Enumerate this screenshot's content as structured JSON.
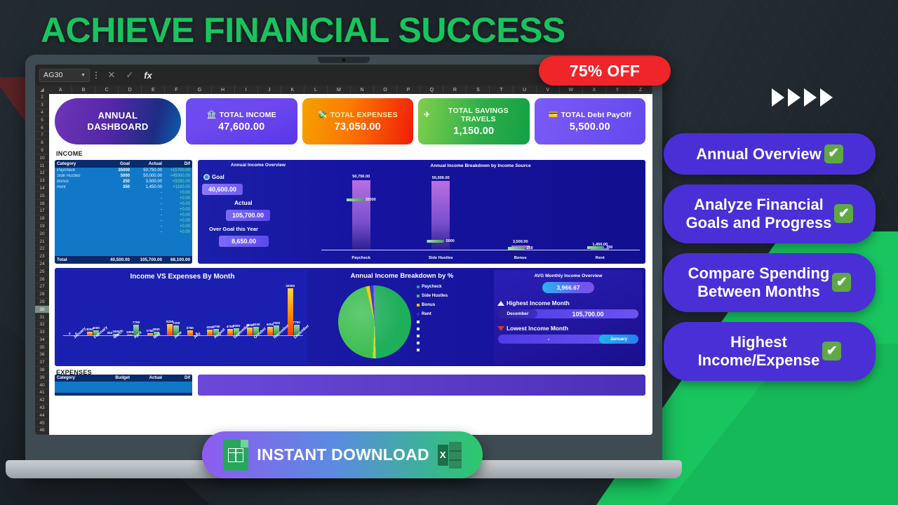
{
  "headline": "ACHIEVE FINANCIAL SUCCESS",
  "offer_badge": "75% OFF",
  "download": {
    "label": "INSTANT DOWNLOAD",
    "excel_letter": "X"
  },
  "badges": [
    {
      "text": "Annual Overview",
      "check": "✔"
    },
    {
      "text": "Analyze Financial\nGoals and Progress",
      "check": "✔"
    },
    {
      "text": "Compare Spending\nBetween Months",
      "check": "✔"
    },
    {
      "text": "Highest\nIncome/Expense",
      "check": "✔"
    }
  ],
  "spreadsheet": {
    "name_box": "AG30",
    "cancel_icon": "✕",
    "confirm_icon": "✓",
    "fx_label": "fx",
    "menu_icon": "⋮",
    "columns": [
      "A",
      "B",
      "C",
      "D",
      "E",
      "F",
      "G",
      "H",
      "I",
      "J",
      "K",
      "L",
      "M",
      "N",
      "O",
      "P",
      "Q",
      "R",
      "S",
      "T",
      "U",
      "V",
      "W",
      "X",
      "Y",
      "Z"
    ],
    "rows": [
      2,
      3,
      4,
      5,
      6,
      7,
      8,
      9,
      10,
      11,
      12,
      13,
      14,
      15,
      16,
      17,
      18,
      19,
      20,
      21,
      22,
      23,
      24,
      25,
      26,
      27,
      28,
      29,
      30,
      31,
      32,
      33,
      34,
      35,
      36,
      37,
      38,
      39,
      40,
      41,
      42,
      43,
      44,
      45,
      46
    ],
    "selected_row": 30
  },
  "dashboard": {
    "title_line1": "ANNUAL",
    "title_line2": "DASHBOARD",
    "kpis": [
      {
        "label": "TOTAL INCOME",
        "value": "47,600.00",
        "icon": "🏦",
        "color": "#6a4df0"
      },
      {
        "label": "TOTAL EXPENSES",
        "value": "73,050.00",
        "icon": "💸",
        "color": "#f5a100"
      },
      {
        "label": "TOTAL SAVINGS TRAVELS",
        "value": "1,150.00",
        "icon": "✈",
        "color": "#2fae4a"
      },
      {
        "label": "TOTAL Debt PayOff",
        "value": "5,500.00",
        "icon": "💳",
        "color": "#7b5bf5"
      }
    ],
    "section_income": "INCOME",
    "section_expenses": "EXPENSES",
    "income_table": {
      "headers": [
        "Category",
        "Goal",
        "Actual",
        "Dif"
      ],
      "rows": [
        {
          "category": "Paycheck",
          "goal": "35000",
          "actual": "50,750.00",
          "dif": "+15750.00"
        },
        {
          "category": "Side Hustles",
          "goal": "5000",
          "actual": "50,000.00",
          "dif": "+45000.00"
        },
        {
          "category": "Bonus",
          "goal": "250",
          "actual": "3,500.00",
          "dif": "+3250.00"
        },
        {
          "category": "Rent",
          "goal": "350",
          "actual": "1,450.00",
          "dif": "+1100.00"
        },
        {
          "category": "",
          "goal": "",
          "actual": "-",
          "dif": "+0.00"
        },
        {
          "category": "",
          "goal": "",
          "actual": "-",
          "dif": "+0.00"
        },
        {
          "category": "",
          "goal": "",
          "actual": "-",
          "dif": "+0.00"
        },
        {
          "category": "",
          "goal": "",
          "actual": "-",
          "dif": "+0.00"
        },
        {
          "category": "",
          "goal": "",
          "actual": "-",
          "dif": "+0.00"
        },
        {
          "category": "",
          "goal": "",
          "actual": "-",
          "dif": "+0.00"
        },
        {
          "category": "",
          "goal": "",
          "actual": "-",
          "dif": "+0.00"
        },
        {
          "category": "",
          "goal": "",
          "actual": "-",
          "dif": "+0.00"
        }
      ],
      "total": {
        "label": "Total",
        "goal": "40,500.00",
        "actual": "105,700.00",
        "dif": "68,100.00"
      }
    },
    "expenses_table": {
      "headers": [
        "Category",
        "Budget",
        "Actual",
        "Dif"
      ]
    },
    "income_overview": {
      "title": "Annual Income Overview",
      "goal_label": "Goal",
      "goal_value": "40,600.00",
      "actual_label": "Actual",
      "actual_value": "105,700.00",
      "over_label": "Over Goal this Year",
      "over_value": "8,650.00"
    },
    "avg_panel": {
      "title": "AVG Monthly Income Overview",
      "avg_value": "3,966.67",
      "highest_label": "Highest Income Month",
      "highest_month": "December",
      "highest_value": "105,700.00",
      "lowest_label": "Lowest Income Month",
      "lowest_month": "January",
      "lowest_value": "-"
    }
  },
  "chart_data": [
    {
      "type": "bar",
      "title": "Annual Income Breakdown by Income Source",
      "categories": [
        "Paycheck",
        "Side Hustles",
        "Bonus",
        "Rent"
      ],
      "series": [
        {
          "name": "Actual",
          "values": [
            50750,
            50000,
            3500,
            1450
          ],
          "labels": [
            "50,750.00",
            "50,000.00",
            "3,500.00",
            "1,450.00"
          ]
        },
        {
          "name": "Goal",
          "values": [
            35000,
            5000,
            250,
            350
          ],
          "labels": [
            "35000",
            "5000",
            "250",
            "350"
          ]
        }
      ],
      "ylim": [
        0,
        55000
      ],
      "grid": false,
      "legend": "none"
    },
    {
      "type": "bar",
      "title": "Income VS Expenses By Month",
      "categories": [
        "January",
        "February",
        "March",
        "April",
        "May",
        "June",
        "July",
        "August",
        "September",
        "October",
        "November",
        "December"
      ],
      "series": [
        {
          "name": "Income",
          "values": [
            0,
            4000,
            1600,
            7750,
            2800,
            7100,
            0,
            4750,
            5000,
            6240,
            7000,
            7750
          ]
        },
        {
          "name": "Expenses",
          "values": [
            0,
            3000,
            250,
            1000,
            1750,
            8250,
            3750,
            4250,
            4750,
            5500,
            6250,
            32000
          ]
        }
      ],
      "labels_income": [
        "0",
        "4000",
        "1600",
        "7750",
        "2800",
        "7100",
        "0",
        "4750",
        "5000",
        "6240",
        "7000",
        "7750"
      ],
      "labels_expenses": [
        "0",
        "3000",
        "250",
        "1000",
        "1750",
        "8250",
        "3750",
        "4250",
        "4750",
        "5500",
        "6250",
        "32000"
      ],
      "ylim": [
        0,
        32000
      ],
      "grid": false
    },
    {
      "type": "pie",
      "title": "Annual Income Breakdown by %",
      "labels": [
        "Paycheck",
        "Side Hustles",
        "Bonus",
        "Rent"
      ],
      "values": [
        48.0,
        47.3,
        3.3,
        1.4
      ],
      "colors": [
        "#1fae5a",
        "#3fbf52",
        "#f5c400",
        "#2a2ad8"
      ],
      "legend": "right"
    }
  ]
}
